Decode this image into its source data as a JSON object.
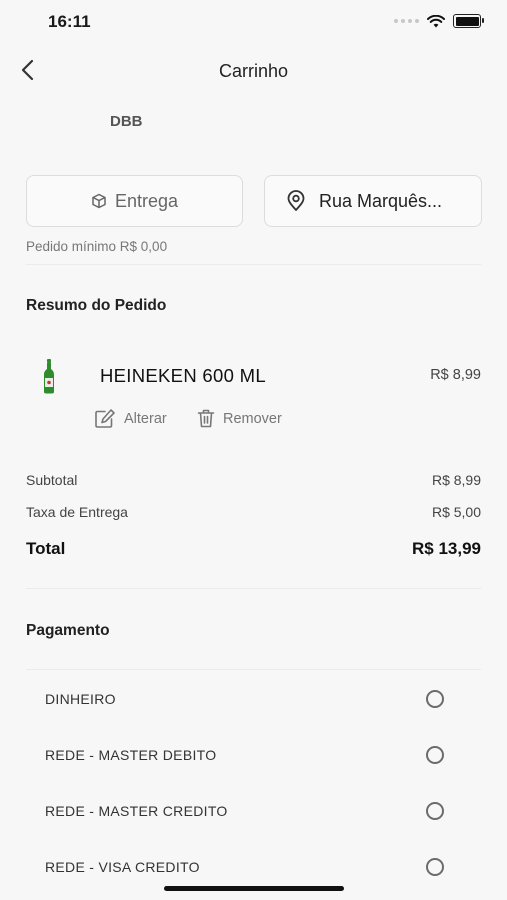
{
  "status_bar": {
    "time": "16:11"
  },
  "header": {
    "title": "Carrinho",
    "back_icon": "chevron-left-icon"
  },
  "store": {
    "name": "DBB"
  },
  "delivery": {
    "mode_label": "Entrega",
    "mode_icon": "box-icon",
    "address_label": "Rua Marquês...",
    "address_icon": "map-pin-icon",
    "min_order": "Pedido mínimo R$ 0,00"
  },
  "order_summary": {
    "title": "Resumo do Pedido",
    "items": [
      {
        "name": "HEINEKEN 600 ML",
        "price": "R$ 8,99",
        "edit_label": "Alterar",
        "remove_label": "Remover"
      }
    ]
  },
  "totals": {
    "subtotal_label": "Subtotal",
    "subtotal_value": "R$ 8,99",
    "delivery_fee_label": "Taxa de Entrega",
    "delivery_fee_value": "R$ 5,00",
    "total_label": "Total",
    "total_value": "R$ 13,99"
  },
  "payment": {
    "title": "Pagamento",
    "options": [
      {
        "label": "DINHEIRO",
        "selected": false
      },
      {
        "label": "REDE - MASTER DEBITO",
        "selected": false
      },
      {
        "label": "REDE - MASTER CREDITO",
        "selected": false
      },
      {
        "label": "REDE - VISA CREDITO",
        "selected": false
      }
    ]
  },
  "colors": {
    "background": "#f7f7f7",
    "text": "#1a1a1a",
    "muted": "#777777",
    "border": "#dcdcdc",
    "bottle": "#2e8b2e"
  }
}
